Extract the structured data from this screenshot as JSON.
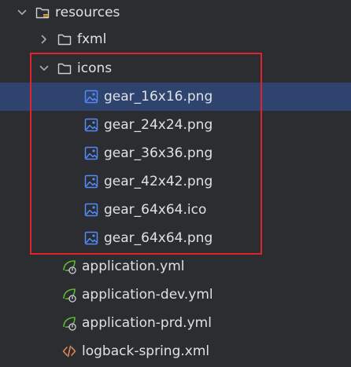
{
  "tree": {
    "root": {
      "label": "resources",
      "expanded": true,
      "icon": "resources-folder-icon"
    },
    "folders": [
      {
        "label": "fxml",
        "expanded": false,
        "icon": "folder-icon"
      },
      {
        "label": "icons",
        "expanded": true,
        "icon": "folder-icon"
      }
    ],
    "icon_files": [
      {
        "label": "gear_16x16.png",
        "icon": "image-file-icon",
        "selected": true
      },
      {
        "label": "gear_24x24.png",
        "icon": "image-file-icon"
      },
      {
        "label": "gear_36x36.png",
        "icon": "image-file-icon"
      },
      {
        "label": "gear_42x42.png",
        "icon": "image-file-icon"
      },
      {
        "label": "gear_64x64.ico",
        "icon": "image-file-icon"
      },
      {
        "label": "gear_64x64.png",
        "icon": "image-file-icon"
      }
    ],
    "config_files": [
      {
        "label": "application.yml",
        "icon": "spring-config-icon"
      },
      {
        "label": "application-dev.yml",
        "icon": "spring-config-icon"
      },
      {
        "label": "application-prd.yml",
        "icon": "spring-config-icon"
      },
      {
        "label": "logback-spring.xml",
        "icon": "xml-file-icon"
      }
    ]
  },
  "colors": {
    "background": "#2b2d30",
    "selection": "#2e436e",
    "text": "#dfe1e5",
    "highlight_border": "#e0242b",
    "image_icon": "#548af7",
    "spring_icon": "#5fb832",
    "xml_icon": "#e08855"
  }
}
